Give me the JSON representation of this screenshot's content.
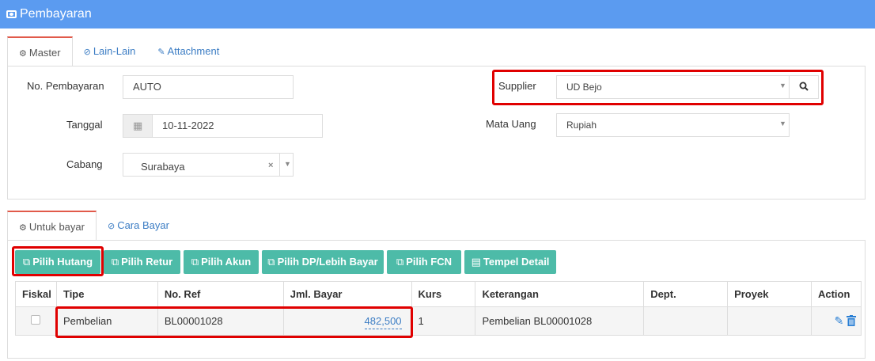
{
  "window": {
    "title": "Pembayaran"
  },
  "top_tabs": [
    {
      "label": "Master"
    },
    {
      "label": "Lain-Lain"
    },
    {
      "label": "Attachment"
    }
  ],
  "form": {
    "no_pembayaran": {
      "label": "No. Pembayaran",
      "value": "AUTO"
    },
    "tanggal": {
      "label": "Tanggal",
      "value": "10-11-2022"
    },
    "cabang": {
      "label": "Cabang",
      "value": "Surabaya"
    },
    "supplier": {
      "label": "Supplier",
      "value": "UD Bejo"
    },
    "mata_uang": {
      "label": "Mata Uang",
      "value": "Rupiah"
    }
  },
  "bottom_tabs": [
    {
      "label": "Untuk bayar"
    },
    {
      "label": "Cara Bayar"
    }
  ],
  "toolbar": [
    {
      "label": "Pilih Hutang"
    },
    {
      "label": "Pilih Retur"
    },
    {
      "label": "Pilih Akun"
    },
    {
      "label": "Pilih DP/Lebih Bayar"
    },
    {
      "label": "Pilih FCN"
    },
    {
      "label": "Tempel Detail"
    }
  ],
  "table": {
    "columns": [
      "Fiskal",
      "Tipe",
      "No. Ref",
      "Jml. Bayar",
      "Kurs",
      "Keterangan",
      "Dept.",
      "Proyek",
      "Action"
    ],
    "rows": [
      {
        "fiskal": false,
        "tipe": "Pembelian",
        "no_ref": "BL00001028",
        "jml_bayar": "482,500",
        "kurs": "1",
        "keterangan": "Pembelian BL00001028",
        "dept": "",
        "proyek": ""
      }
    ]
  },
  "colors": {
    "header": "#5b9bf0",
    "button": "#4dbba8",
    "highlight": "#e00000",
    "link": "#3c7dc4"
  }
}
